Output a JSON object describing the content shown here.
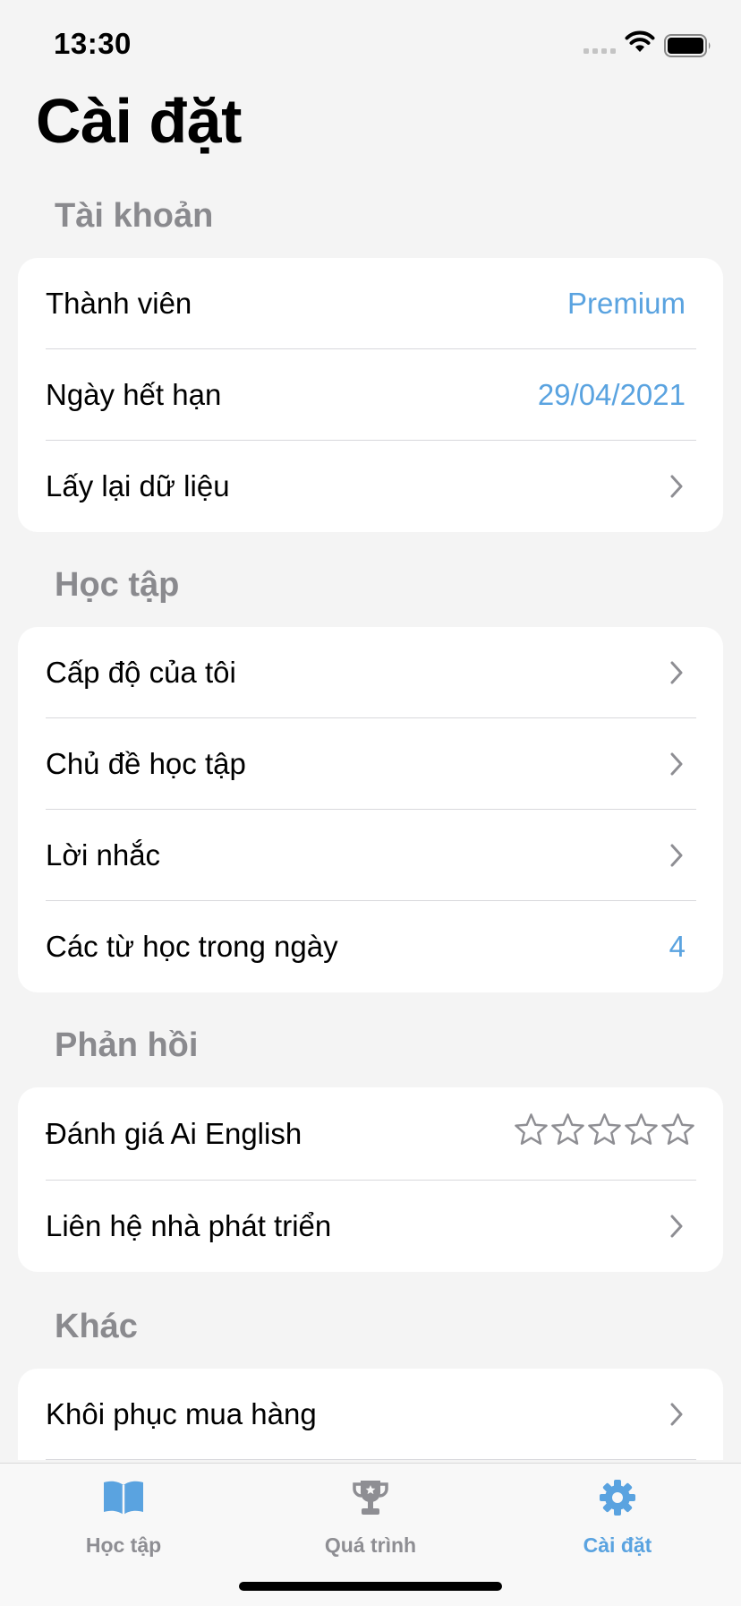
{
  "status_bar": {
    "time": "13:30"
  },
  "page_title": "Cài đặt",
  "sections": [
    {
      "header": "Tài khoản",
      "rows": [
        {
          "label": "Thành viên",
          "value": "Premium"
        },
        {
          "label": "Ngày hết hạn",
          "value": "29/04/2021"
        },
        {
          "label": "Lấy lại dữ liệu",
          "accessory": "chevron"
        }
      ]
    },
    {
      "header": "Học tập",
      "rows": [
        {
          "label": "Cấp độ của tôi",
          "accessory": "chevron"
        },
        {
          "label": "Chủ đề học tập",
          "accessory": "chevron"
        },
        {
          "label": "Lời nhắc",
          "accessory": "chevron"
        },
        {
          "label": "Các từ học trong ngày",
          "value": "4"
        }
      ]
    },
    {
      "header": "Phản hồi",
      "rows": [
        {
          "label": "Đánh giá Ai English",
          "accessory": "stars",
          "rating": 0,
          "rating_max": 5
        },
        {
          "label": "Liên hệ nhà phát triển",
          "accessory": "chevron"
        }
      ]
    },
    {
      "header": "Khác",
      "rows": [
        {
          "label": "Khôi phục mua hàng",
          "accessory": "chevron"
        }
      ]
    }
  ],
  "tab_bar": {
    "tabs": [
      {
        "label": "Học tập",
        "icon": "book-icon",
        "active": false
      },
      {
        "label": "Quá trình",
        "icon": "trophy-icon",
        "active": false
      },
      {
        "label": "Cài đặt",
        "icon": "gear-icon",
        "active": true
      }
    ]
  },
  "colors": {
    "accent": "#5aa3e0",
    "background": "#f4f4f4",
    "section_header": "#8a8a8e",
    "inactive_tab": "#8e8e93"
  }
}
